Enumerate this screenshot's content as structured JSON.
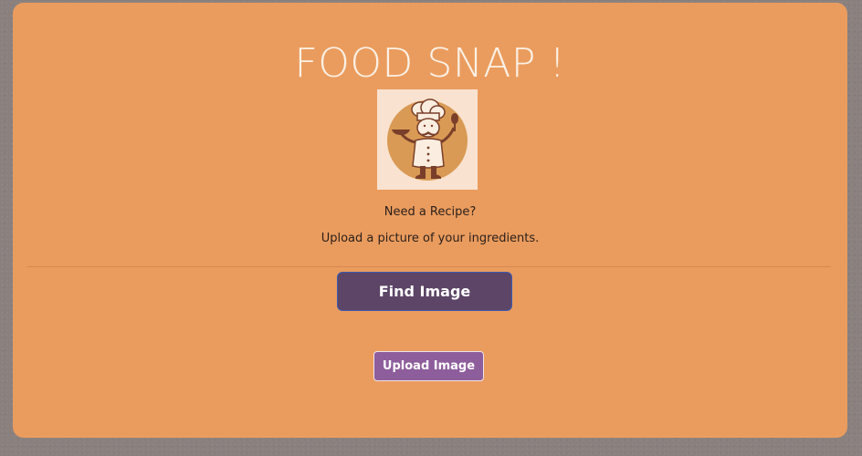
{
  "header": {
    "title": "FOOD SNAP !"
  },
  "logo": {
    "icon": "chef-icon"
  },
  "intro": {
    "question": "Need a Recipe?",
    "instruction": "Upload a picture of your ingredients."
  },
  "actions": {
    "find_label": "Find Image",
    "upload_label": "Upload Image"
  },
  "colors": {
    "page_background": "#8a817f",
    "card_background": "#ea9c5e",
    "find_button": "#5c4566",
    "upload_button": "#8e5e9c",
    "title_text": "#fbf1e6"
  }
}
